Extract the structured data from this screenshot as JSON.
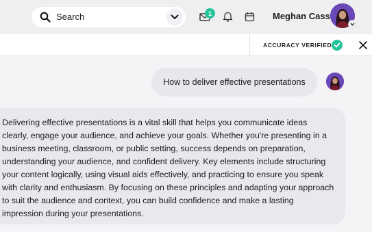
{
  "search": {
    "label": "Search"
  },
  "notifications": {
    "mail_count": "1"
  },
  "user": {
    "name": "Meghan Cass"
  },
  "accuracy": {
    "label": "ACCURACY VERIFIED"
  },
  "chat": {
    "question": "How to deliver effective presentations",
    "answer": "Delivering effective presentations is a vital skill that helps you communicate ideas clearly, engage your audience, and achieve your goals. Whether you're presenting in a business meeting, classroom, or public setting, success depends on preparation, understanding your audience, and confident delivery. Key elements include structuring your content logically, using visual aids effectively, and practicing to ensure you speak with clarity and enthusiasm. By focusing on these principles and adapting your approach to suit the audience and context, you can build confidence and make a lasting impression during your presentations."
  },
  "icons": [
    "search-icon",
    "chevron-down-icon",
    "mail-icon",
    "bell-icon",
    "calendar-icon",
    "check-icon",
    "close-icon"
  ],
  "colors": {
    "accent_green": "#25c49a",
    "avatar_purple": "#5b3ea8"
  }
}
